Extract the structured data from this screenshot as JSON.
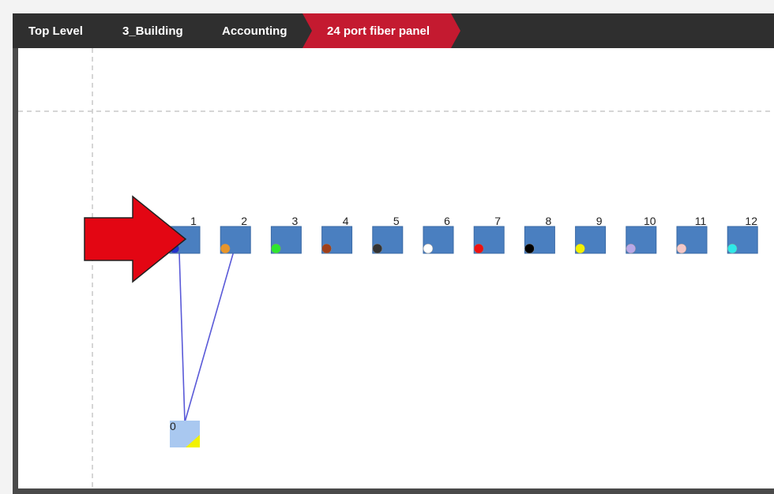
{
  "breadcrumb": [
    {
      "label": "Top Level"
    },
    {
      "label": "3_Building"
    },
    {
      "label": "Accounting"
    },
    {
      "label": "24 port fiber panel",
      "active": true
    }
  ],
  "colors": {
    "active_crumb": "#c41a30",
    "port_fill": "#4a7fc0",
    "device_fill": "#a9c8f0",
    "link": "#5a5ad8",
    "arrow": "#e30613"
  },
  "ports": [
    {
      "label": "1",
      "color": "#2233cc"
    },
    {
      "label": "2",
      "color": "#e8952a"
    },
    {
      "label": "3",
      "color": "#2ee62e"
    },
    {
      "label": "4",
      "color": "#a0401a"
    },
    {
      "label": "5",
      "color": "#333333"
    },
    {
      "label": "6",
      "color": "#ffffff"
    },
    {
      "label": "7",
      "color": "#ee1111"
    },
    {
      "label": "8",
      "color": "#000000"
    },
    {
      "label": "9",
      "color": "#f2f200"
    },
    {
      "label": "10",
      "color": "#b8a8e8"
    },
    {
      "label": "11",
      "color": "#f4c8c8"
    },
    {
      "label": "12",
      "color": "#2ee8e8"
    }
  ],
  "device": {
    "label": "0",
    "color": "#f2f200"
  },
  "connections": [
    "1",
    "2"
  ]
}
